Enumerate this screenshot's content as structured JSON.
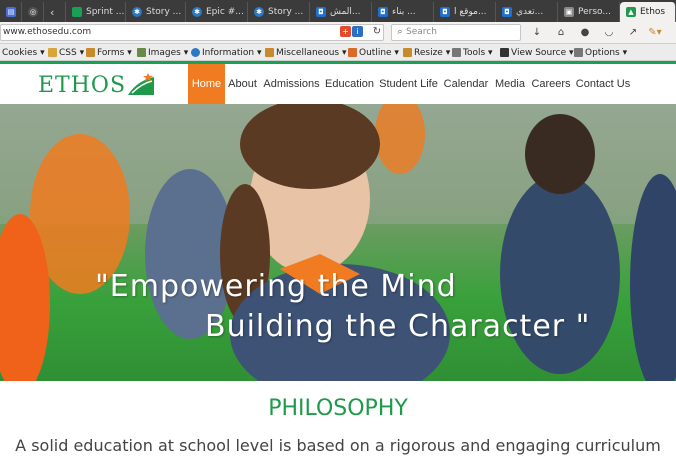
{
  "browser": {
    "tabs": [
      {
        "label": "",
        "color": "#4a6fd6"
      },
      {
        "label": "",
        "color": "#555"
      },
      {
        "label": "Sprint ...",
        "color": "#1aa053"
      },
      {
        "label": "Story ...",
        "color": "#2b78c5"
      },
      {
        "label": "Epic #...",
        "color": "#2b78c5"
      },
      {
        "label": "Story ...",
        "color": "#2b78c5"
      },
      {
        "label": "المش...",
        "color": "#1f6fd1"
      },
      {
        "label": "بناء ...",
        "color": "#1f6fd1"
      },
      {
        "label": "موقع ا...",
        "color": "#1f6fd1"
      },
      {
        "label": "تعدي...",
        "color": "#1f6fd1"
      },
      {
        "label": "Perso...",
        "color": "#888"
      },
      {
        "label": "Ethos",
        "color": "#1e9a4a"
      }
    ],
    "url": "www.ethosedu.com",
    "search_placeholder": "Search",
    "devtoolbar": [
      {
        "label": "Cookies ▾",
        "color": "#c98a2b"
      },
      {
        "label": "CSS ▾",
        "color": "#d9a53a"
      },
      {
        "label": "Forms ▾",
        "color": "#c98a2b"
      },
      {
        "label": "Images ▾",
        "color": "#6a8a4a"
      },
      {
        "label": "Information ▾",
        "color": "#2b78c5"
      },
      {
        "label": "Miscellaneous ▾",
        "color": "#c98a2b"
      },
      {
        "label": "Outline ▾",
        "color": "#d86b2b"
      },
      {
        "label": "Resize ▾",
        "color": "#c98a2b"
      },
      {
        "label": "Tools ▾",
        "color": "#777"
      },
      {
        "label": "View Source ▾",
        "color": "#333"
      },
      {
        "label": "Options ▾",
        "color": "#777"
      }
    ]
  },
  "site": {
    "logo": "ETHOS",
    "nav": [
      "Home",
      "About",
      "Admissions",
      "Education",
      "Student Life",
      "Calendar",
      "Media",
      "Careers",
      "Contact Us"
    ],
    "hero_line1": "\"Empowering the Mind",
    "hero_line2": "Building the Character \"",
    "section_title": "PHILOSOPHY",
    "section_text": "A solid education at school level is based on a rigorous and engaging curriculum",
    "brand_green": "#1e9a4a",
    "accent_orange": "#f07b20"
  }
}
